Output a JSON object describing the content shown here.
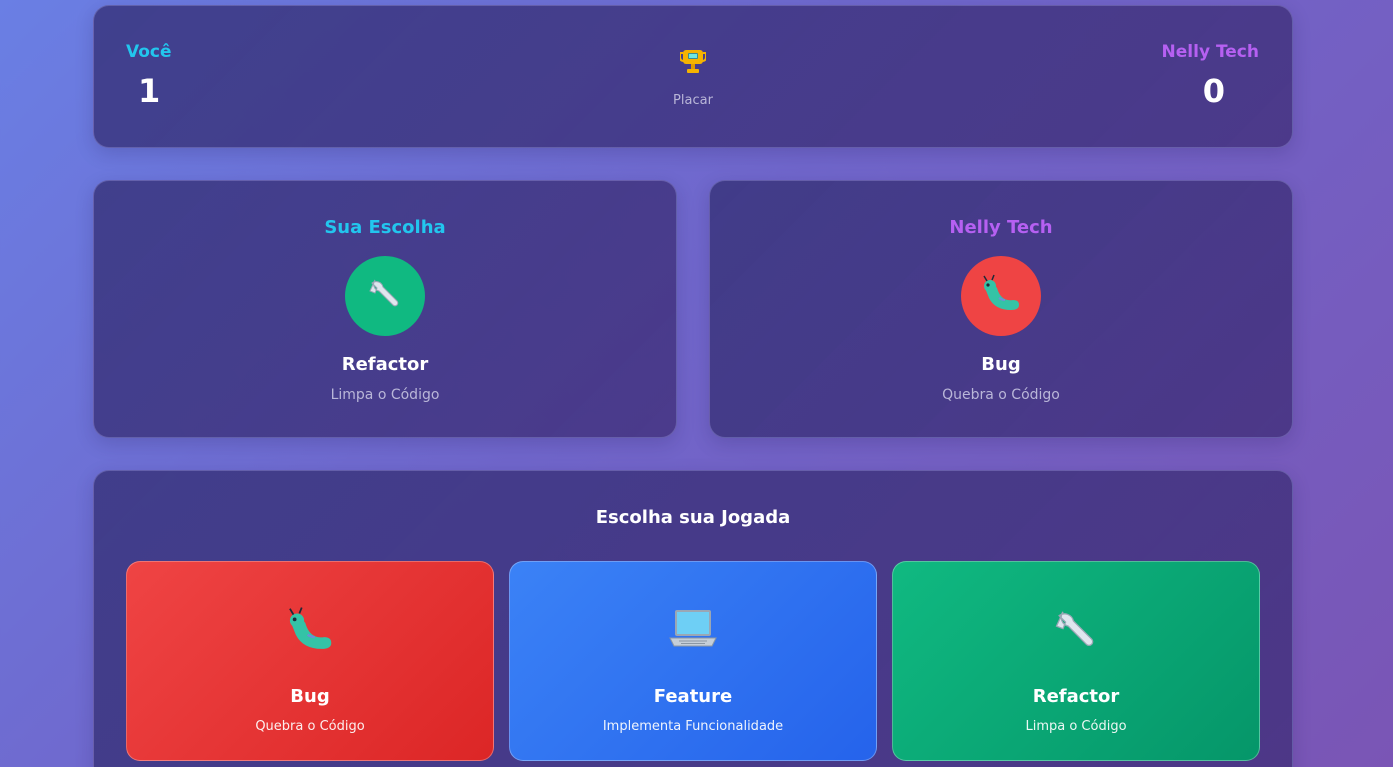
{
  "scoreboard": {
    "player_label": "Você",
    "player_score": "1",
    "center_label": "Placar",
    "cpu_label": "Nelly Tech",
    "cpu_score": "0"
  },
  "player_choice": {
    "title": "Sua Escolha",
    "icon": "wrench-icon",
    "name": "Refactor",
    "description": "Limpa o Código"
  },
  "cpu_choice": {
    "title": "Nelly Tech",
    "icon": "bug-icon",
    "name": "Bug",
    "description": "Quebra o Código"
  },
  "moves": {
    "title": "Escolha sua Jogada",
    "items": [
      {
        "icon": "bug-icon",
        "name": "Bug",
        "description": "Quebra o Código",
        "color": "#ef4444"
      },
      {
        "icon": "laptop-icon",
        "name": "Feature",
        "description": "Implementa Funcionalidade",
        "color": "#3b82f6"
      },
      {
        "icon": "wrench-icon",
        "name": "Refactor",
        "description": "Limpa o Código",
        "color": "#10b981"
      }
    ]
  },
  "colors": {
    "player_accent": "#22c6ee",
    "cpu_accent": "#b660f2"
  }
}
